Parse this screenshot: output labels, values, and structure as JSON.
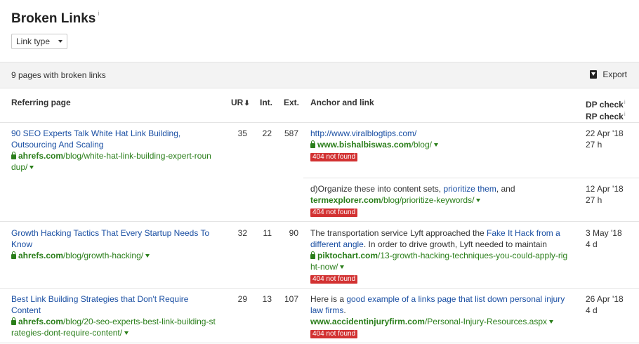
{
  "page": {
    "title": "Broken Links",
    "title_info": "i",
    "filter": {
      "link_type_label": "Link type"
    },
    "summary": "9 pages with broken links",
    "export_label": "Export"
  },
  "columns": {
    "referring_page": "Referring page",
    "ur": "UR",
    "ur_sort": "⬇",
    "int": "Int.",
    "ext": "Ext.",
    "anchor": "Anchor and link",
    "dp_check": "DP check",
    "rp_check": "RP check",
    "info": "i"
  },
  "colors": {
    "link_blue": "#1a4fa3",
    "url_green": "#2a7e1a",
    "badge_red": "#d23131",
    "toolbar_bg": "#f3f3f3"
  },
  "rows": [
    {
      "title_l1": "90 SEO Experts Talk White Hat Link Building,",
      "title_l2": "Outsourcing And Scaling",
      "domain": "ahrefs.com",
      "path_l1": "/blog/white-hat-link-building-expert-roun",
      "path_l2": "dup/",
      "ur": "35",
      "int": "22",
      "ext": "587",
      "links": [
        {
          "anchor": "http://www.viralblogtips.com/",
          "domain": "www.bishalbiswas.com",
          "path": "/blog/",
          "status": "404 not found",
          "dp": "22 Apr '18",
          "rp": "27 h"
        },
        {
          "pre": "d)Organize these into content sets,",
          "anchor": "prioritize them",
          "post": ", and",
          "domain": "termexplorer.com",
          "path": "/blog/prioritize-keywords/",
          "status": "404 not found",
          "dp": "12 Apr '18",
          "rp": "27 h"
        }
      ]
    },
    {
      "title_l1": "Growth Hacking Tactics That Every Startup Needs To",
      "title_l2": "Know",
      "domain": "ahrefs.com",
      "path_l1": "/blog/growth-hacking/",
      "ur": "32",
      "int": "11",
      "ext": "90",
      "links": [
        {
          "pre": "The transportation service Lyft approached the",
          "anchor_l1": "Fake It Hack from a",
          "anchor_l2": "different angle",
          "post": ". In order to drive growth, Lyft needed to maintain",
          "domain": "piktochart.com",
          "path_l1": "/13-growth-hacking-techniques-you-could-apply-rig",
          "path_l2": "ht-now/",
          "status": "404 not found",
          "dp": "3 May '18",
          "rp": "4 d"
        }
      ]
    },
    {
      "title_l1": "Best Link Building Strategies that Don't Require",
      "title_l2": "Content",
      "domain": "ahrefs.com",
      "path_l1": "/blog/20-seo-experts-best-link-building-st",
      "path_l2": "rategies-dont-require-content/",
      "ur": "29",
      "int": "13",
      "ext": "107",
      "links": [
        {
          "pre": "Here is a",
          "anchor_l1": "good example of a links page that list down personal injury",
          "anchor_l2": "law firms",
          "post": ".",
          "domain": "www.accidentinjuryfirm.com",
          "path": "/Personal-Injury-Resources.aspx",
          "status": "404 not found",
          "dp": "26 Apr '18",
          "rp": "4 d"
        }
      ]
    }
  ]
}
